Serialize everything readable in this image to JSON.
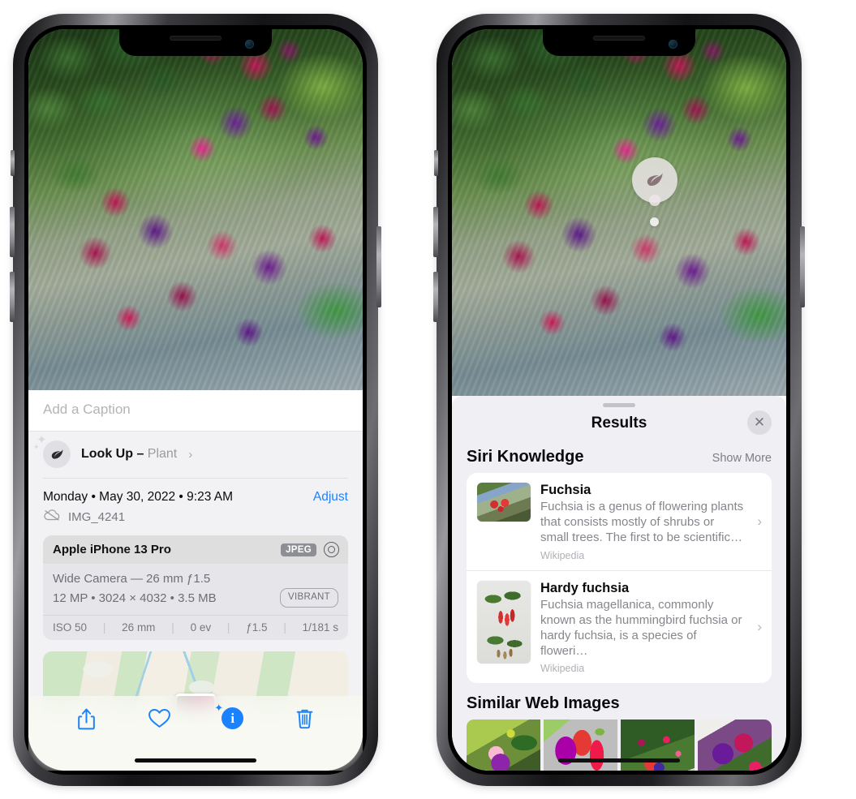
{
  "left_phone": {
    "photo": {
      "alt": "fuchsia-flowers-photo"
    },
    "caption": {
      "placeholder": "Add a Caption",
      "value": ""
    },
    "lookup": {
      "icon": "leaf-icon",
      "sparkle": "sparkle-icon",
      "label": "Look Up – ",
      "subject": "Plant",
      "chevron": "›"
    },
    "date_row": {
      "date": "Monday • May 30, 2022 • 9:23 AM",
      "adjust_label": "Adjust"
    },
    "file_row": {
      "icon": "icloud-slash-icon",
      "filename": "IMG_4241"
    },
    "exif": {
      "device": "Apple iPhone 13 Pro",
      "format_tag": "JPEG",
      "aperture_icon": "aperture-icon",
      "lens_line": "Wide Camera — 26 mm ƒ1.5",
      "size_line": "12 MP • 3024 × 4032 • 3.5 MB",
      "quality_tag": "VIBRANT",
      "stats": [
        "ISO 50",
        "26 mm",
        "0 ev",
        "ƒ1.5",
        "1/181 s"
      ]
    },
    "map": {
      "pin": "photo-pin-thumbnail"
    },
    "toolbar": [
      {
        "name": "share-button",
        "icon": "share-icon"
      },
      {
        "name": "favorite-button",
        "icon": "heart-icon"
      },
      {
        "name": "info-button",
        "icon": "info-circle-icon",
        "glyph": "i"
      },
      {
        "name": "delete-button",
        "icon": "trash-icon"
      }
    ]
  },
  "right_phone": {
    "visual_lookup_badge": {
      "icon": "leaf-icon"
    },
    "sheet": {
      "grabber": "sheet-grabber",
      "title": "Results",
      "close_icon": "✕"
    },
    "siri_knowledge": {
      "title": "Siri Knowledge",
      "show_more": "Show More",
      "items": [
        {
          "thumb": "fuchsia-thumbnail",
          "title": "Fuchsia",
          "description": "Fuchsia is a genus of flowering plants that consists mostly of shrubs or small trees. The first to be scientific…",
          "source": "Wikipedia",
          "chevron": "›"
        },
        {
          "thumb": "hardy-fuchsia-thumbnail",
          "title": "Hardy fuchsia",
          "description": "Fuchsia magellanica, commonly known as the hummingbird fuchsia or hardy fuchsia, is a species of floweri…",
          "source": "Wikipedia",
          "chevron": "›"
        }
      ]
    },
    "similar_web_images": {
      "title": "Similar Web Images",
      "images": [
        {
          "name": "web-image-1"
        },
        {
          "name": "web-image-2"
        },
        {
          "name": "web-image-3"
        },
        {
          "name": "web-image-4"
        }
      ]
    }
  },
  "colors": {
    "accent_blue": "#1a82ff",
    "sheet_bg": "#f0eff4",
    "panel_bg": "#f2f2f5",
    "card_bg": "#ffffff",
    "exif_bg": "#e6e6ea"
  }
}
